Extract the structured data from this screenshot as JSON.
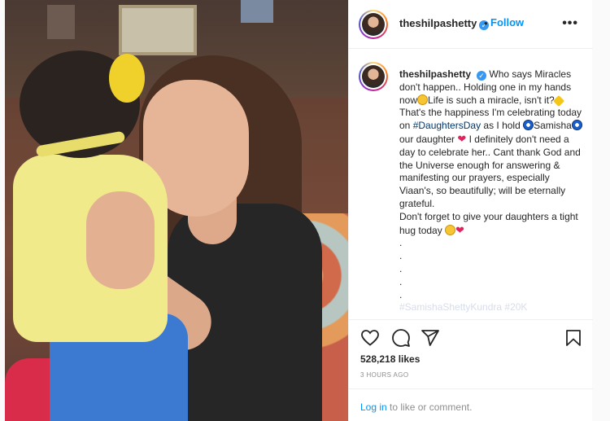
{
  "post": {
    "username": "theshilpashetty",
    "separator": "•",
    "follow_label": "Follow",
    "more_label": "•••",
    "verified_mark": "✓"
  },
  "caption": {
    "username": "theshilpashetty",
    "t1": "Who says Miracles don't happen.. Holding one in my hands now",
    "t2": "Life is such a miracle, isn't it?",
    "t3": " That's the happiness I'm celebrating today on ",
    "hashtag": "#DaughtersDay",
    "t4": " as I hold ",
    "name": "Samisha",
    "t5": " our daughter ",
    "t6": " I definitely don't need a day to celebrate her.. Cant thank God and the Universe enough for answering & manifesting our prayers, especially Viaan's, so beautifully; will be eternally grateful.",
    "t7": "Don't forget to give your daughters a tight hug today ",
    "dot": ".",
    "heart": "❤",
    "cutoff": "#SamishaShettyKundra #20K"
  },
  "stats": {
    "likes": "528,218 likes",
    "time_ago": "3 HOURS AGO"
  },
  "footer": {
    "login_link": "Log in",
    "login_text": " to like or comment."
  },
  "icons": [
    "heart-icon",
    "comment-icon",
    "share-icon",
    "bookmark-icon"
  ]
}
